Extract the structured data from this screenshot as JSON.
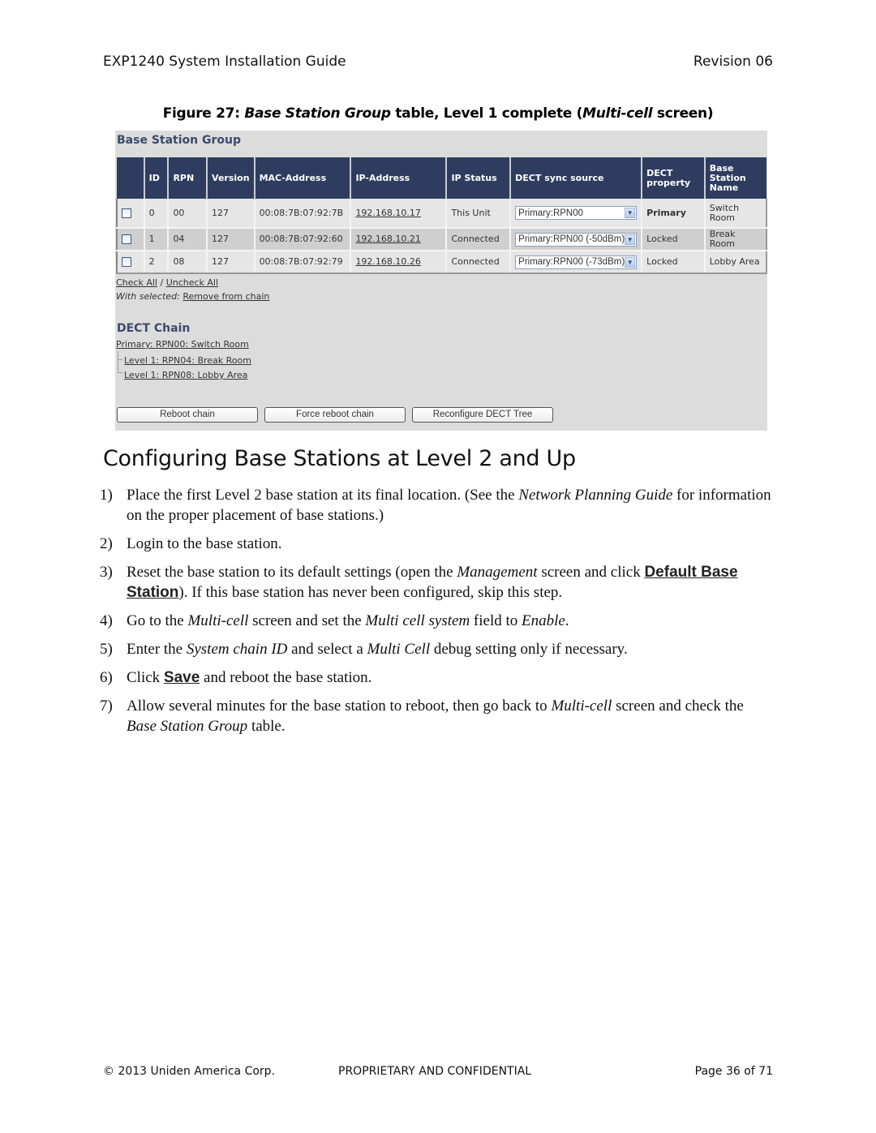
{
  "header": {
    "title": "EXP1240 System Installation Guide",
    "revision": "Revision 06"
  },
  "figure": {
    "caption_prefix": "Figure 27: ",
    "caption_italic_1": "Base Station Group",
    "caption_mid": " table, Level 1 complete (",
    "caption_italic_2": "Multi-cell",
    "caption_suffix": " screen)"
  },
  "screen": {
    "bsg_title": "Base Station Group",
    "columns": [
      "",
      "ID",
      "RPN",
      "Version",
      "MAC-Address",
      "IP-Address",
      "IP Status",
      "DECT sync source",
      "DECT property",
      "Base Station Name"
    ],
    "rows": [
      {
        "checked": false,
        "id": "0",
        "rpn": "00",
        "version": "127",
        "mac": "00:08:7B:07:92:7B",
        "ip": "192.168.10.17",
        "ip_status": "This Unit",
        "sync_source": "Primary:RPN00",
        "property": "Primary",
        "name": "Switch Room"
      },
      {
        "checked": false,
        "id": "1",
        "rpn": "04",
        "version": "127",
        "mac": "00:08:7B:07:92:60",
        "ip": "192.168.10.21",
        "ip_status": "Connected",
        "sync_source": "Primary:RPN00 (-50dBm)",
        "property": "Locked",
        "name": "Break Room"
      },
      {
        "checked": false,
        "id": "2",
        "rpn": "08",
        "version": "127",
        "mac": "00:08:7B:07:92:79",
        "ip": "192.168.10.26",
        "ip_status": "Connected",
        "sync_source": "Primary:RPN00 (-73dBm)",
        "property": "Locked",
        "name": "Lobby Area"
      }
    ],
    "check_all": "Check All",
    "separator": " / ",
    "uncheck_all": "Uncheck All",
    "with_selected": "With selected:",
    "remove_from_chain": "Remove from chain",
    "chain_title": "DECT Chain",
    "chain": [
      "Primary: RPN00: Switch Room",
      "Level 1: RPN04: Break Room",
      "Level 1: RPN08: Lobby Area"
    ],
    "buttons": {
      "reboot_chain": "Reboot chain",
      "force_reboot_chain": "Force reboot chain",
      "reconfigure_tree": "Reconfigure DECT Tree"
    }
  },
  "section": {
    "heading": "Configuring Base Stations at Level 2 and Up"
  },
  "steps": [
    {
      "num": "1)",
      "parts": [
        "Place the first Level 2 base station at its final location. (See the ",
        "Network Planning Guide",
        " for information on the proper placement of base stations.)"
      ]
    },
    {
      "num": "2)",
      "text": "Login to the base station."
    },
    {
      "num": "3)",
      "parts": [
        "Reset the base station to its default settings (open the ",
        "Management",
        " screen and click ",
        "Default Base Station",
        "). If this base station has never been configured, skip this step."
      ]
    },
    {
      "num": "4)",
      "parts": [
        "Go to the ",
        "Multi-cell",
        " screen and set the ",
        "Multi cell system",
        " field to ",
        "Enable",
        "."
      ]
    },
    {
      "num": "5)",
      "parts": [
        "Enter the ",
        "System chain ID",
        " and select a ",
        "Multi Cell",
        " debug setting only if necessary."
      ]
    },
    {
      "num": "6)",
      "parts": [
        "Click ",
        "Save",
        " and reboot the base station."
      ]
    },
    {
      "num": "7)",
      "parts": [
        "Allow several minutes for the base station to reboot, then go back to ",
        "Multi-cell",
        " screen and check the ",
        "Base Station Group",
        " table."
      ]
    }
  ],
  "footer": {
    "copyright": "© 2013 Uniden America Corp.",
    "confidential": "PROPRIETARY AND CONFIDENTIAL",
    "page": "Page 36 of 71"
  }
}
